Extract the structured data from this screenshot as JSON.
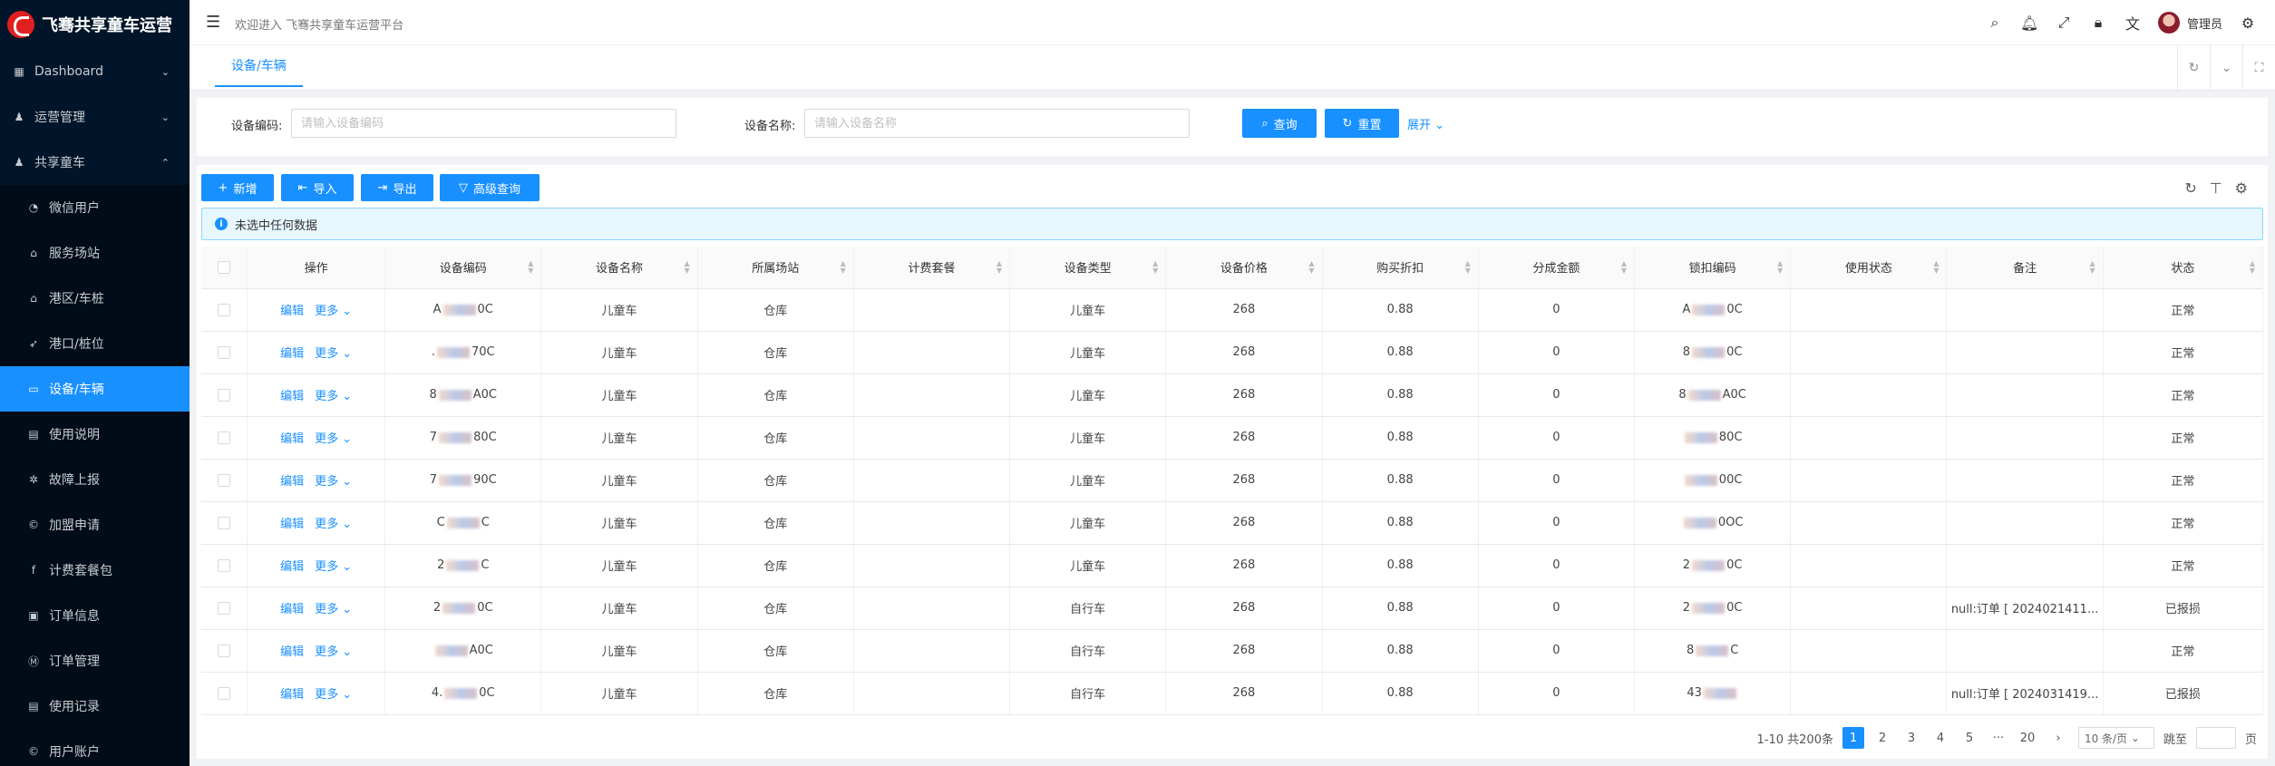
{
  "app": {
    "title": "飞骞共享童车运营"
  },
  "sidebar": {
    "items": [
      {
        "label": "Dashboard",
        "icon": "dashboard-icon",
        "sub": false,
        "arrow": "⌄"
      },
      {
        "label": "运营管理",
        "icon": "user-icon",
        "sub": false,
        "arrow": "⌄"
      },
      {
        "label": "共享童车",
        "icon": "user-icon",
        "sub": false,
        "arrow": "⌃"
      },
      {
        "label": "微信用户",
        "icon": "wechat-icon",
        "sub": true
      },
      {
        "label": "服务场站",
        "icon": "bank-icon",
        "sub": true
      },
      {
        "label": "港区/车桩",
        "icon": "home-icon",
        "sub": true
      },
      {
        "label": "港口/桩位",
        "icon": "rocket-icon",
        "sub": true
      },
      {
        "label": "设备/车辆",
        "icon": "car-icon",
        "sub": true,
        "active": true
      },
      {
        "label": "使用说明",
        "icon": "file-icon",
        "sub": true
      },
      {
        "label": "故障上报",
        "icon": "bug-icon",
        "sub": true
      },
      {
        "label": "加盟申请",
        "icon": "copyright-icon",
        "sub": true
      },
      {
        "label": "计费套餐包",
        "icon": "facebook-icon",
        "sub": true
      },
      {
        "label": "订单信息",
        "icon": "order-icon",
        "sub": true
      },
      {
        "label": "订单管理",
        "icon": "order-manage-icon",
        "sub": true
      },
      {
        "label": "使用记录",
        "icon": "record-icon",
        "sub": true
      },
      {
        "label": "用户账户",
        "icon": "account-icon",
        "sub": true
      }
    ]
  },
  "header": {
    "welcome": "欢迎进入 飞骞共享童车运营平台",
    "user": "管理员"
  },
  "tabs": [
    {
      "label": "设备/车辆"
    }
  ],
  "search": {
    "code_label": "设备编码:",
    "code_placeholder": "请输入设备编码",
    "name_label": "设备名称:",
    "name_placeholder": "请输入设备名称",
    "query": "查询",
    "reset": "重置",
    "expand": "展开"
  },
  "toolbar": {
    "add": "新增",
    "import": "导入",
    "export": "导出",
    "advanced": "高级查询"
  },
  "alert": {
    "text": "未选中任何数据"
  },
  "table": {
    "columns": [
      "操作",
      "设备编码",
      "设备名称",
      "所属场站",
      "计费套餐",
      "设备类型",
      "设备价格",
      "购买折扣",
      "分成金额",
      "锁扣编码",
      "使用状态",
      "备注",
      "状态"
    ],
    "edit_label": "编辑",
    "more_label": "更多",
    "rows": [
      {
        "code_a": "A",
        "code_b": "0C",
        "name": "儿童车",
        "station": "仓库",
        "package": "",
        "type": "儿童车",
        "price": "268",
        "discount": "0.88",
        "share": "0",
        "lock_a": "A",
        "lock_b": "0C",
        "use": "",
        "remark": "",
        "status": "正常"
      },
      {
        "code_a": ".",
        "code_b": "70C",
        "name": "儿童车",
        "station": "仓库",
        "package": "",
        "type": "儿童车",
        "price": "268",
        "discount": "0.88",
        "share": "0",
        "lock_a": "8",
        "lock_b": "0C",
        "use": "",
        "remark": "",
        "status": "正常"
      },
      {
        "code_a": "8",
        "code_b": "A0C",
        "name": "儿童车",
        "station": "仓库",
        "package": "",
        "type": "儿童车",
        "price": "268",
        "discount": "0.88",
        "share": "0",
        "lock_a": "8",
        "lock_b": "A0C",
        "use": "",
        "remark": "",
        "status": "正常"
      },
      {
        "code_a": "7",
        "code_b": "80C",
        "name": "儿童车",
        "station": "仓库",
        "package": "",
        "type": "儿童车",
        "price": "268",
        "discount": "0.88",
        "share": "0",
        "lock_a": "",
        "lock_b": "80C",
        "use": "",
        "remark": "",
        "status": "正常"
      },
      {
        "code_a": "7",
        "code_b": "90C",
        "name": "儿童车",
        "station": "仓库",
        "package": "",
        "type": "儿童车",
        "price": "268",
        "discount": "0.88",
        "share": "0",
        "lock_a": "",
        "lock_b": "00C",
        "use": "",
        "remark": "",
        "status": "正常"
      },
      {
        "code_a": "C",
        "code_b": "C",
        "name": "儿童车",
        "station": "仓库",
        "package": "",
        "type": "儿童车",
        "price": "268",
        "discount": "0.88",
        "share": "0",
        "lock_a": "",
        "lock_b": "0OC",
        "use": "",
        "remark": "",
        "status": "正常"
      },
      {
        "code_a": "2",
        "code_b": "C",
        "name": "儿童车",
        "station": "仓库",
        "package": "",
        "type": "儿童车",
        "price": "268",
        "discount": "0.88",
        "share": "0",
        "lock_a": "2",
        "lock_b": "0C",
        "use": "",
        "remark": "",
        "status": "正常"
      },
      {
        "code_a": "2",
        "code_b": "0C",
        "name": "儿童车",
        "station": "仓库",
        "package": "",
        "type": "自行车",
        "price": "268",
        "discount": "0.88",
        "share": "0",
        "lock_a": "2",
        "lock_b": "0C",
        "use": "",
        "remark": "null:订单 [ 2024021411...",
        "status": "已报损"
      },
      {
        "code_a": "",
        "code_b": "A0C",
        "name": "儿童车",
        "station": "仓库",
        "package": "",
        "type": "自行车",
        "price": "268",
        "discount": "0.88",
        "share": "0",
        "lock_a": "8",
        "lock_b": "C",
        "use": "",
        "remark": "",
        "status": "正常"
      },
      {
        "code_a": "4.",
        "code_b": "0C",
        "name": "儿童车",
        "station": "仓库",
        "package": "",
        "type": "自行车",
        "price": "268",
        "discount": "0.88",
        "share": "0",
        "lock_a": "43",
        "lock_b": "",
        "use": "",
        "remark": "null:订单 [ 2024031419...",
        "status": "已报损"
      }
    ]
  },
  "pagination": {
    "summary": "1-10 共200条",
    "pages": [
      "1",
      "2",
      "3",
      "4",
      "5",
      "···",
      "20"
    ],
    "current": "1",
    "page_size": "10 条/页",
    "jump_label": "跳至",
    "page_suffix": "页"
  }
}
